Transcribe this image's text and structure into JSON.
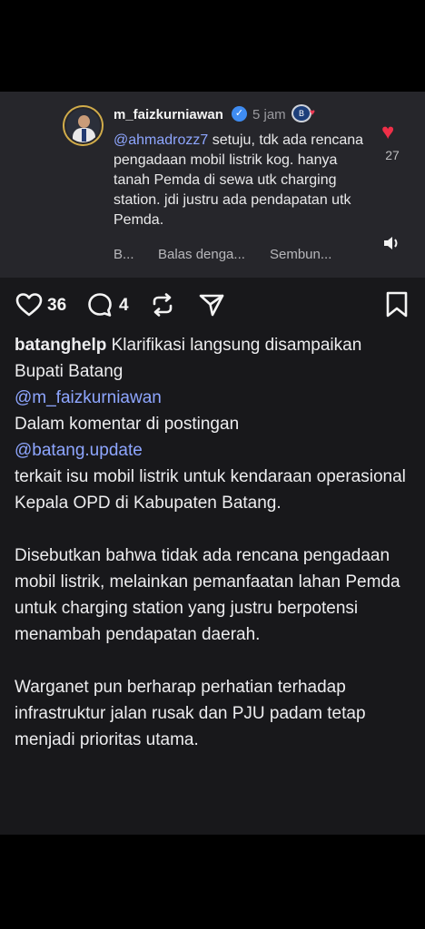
{
  "comment": {
    "username": "m_faizkurniawan",
    "time": "5 jam",
    "mention": "@ahmadrozz7",
    "text": " setuju, tdk ada rencana pengadaan mobil listrik kog. hanya tanah Pemda di sewa utk charging station. jdi justru ada pendapatan utk Pemda.",
    "like_count": "27",
    "actions": [
      "B...",
      "Balas denga...",
      "Sembun..."
    ]
  },
  "post": {
    "like_count": "36",
    "comment_count": "4",
    "username": "batanghelp",
    "intro": " Klarifikasi langsung disampaikan Bupati Batang",
    "mention1": "@m_faizkurniawan",
    "line2": "Dalam komentar  di postingan",
    "mention2": "@batang.update",
    "line3": "terkait isu mobil listrik untuk kendaraan operasional Kepala OPD di Kabupaten Batang.",
    "para2": "Disebutkan bahwa tidak ada rencana pengadaan mobil listrik, melainkan pemanfaatan lahan Pemda untuk charging station yang justru berpotensi menambah pendapatan daerah.",
    "para3": "Warganet pun berharap perhatian terhadap infrastruktur jalan rusak dan PJU padam tetap menjadi prioritas utama."
  },
  "colors": {
    "mention": "#8ea6ff",
    "like_red": "#ef2f48",
    "verified_blue": "#3f8cf2"
  },
  "icons": [
    "verified-icon",
    "heart-icon",
    "comment-icon",
    "repost-icon",
    "share-icon",
    "bookmark-icon",
    "speaker-icon"
  ]
}
